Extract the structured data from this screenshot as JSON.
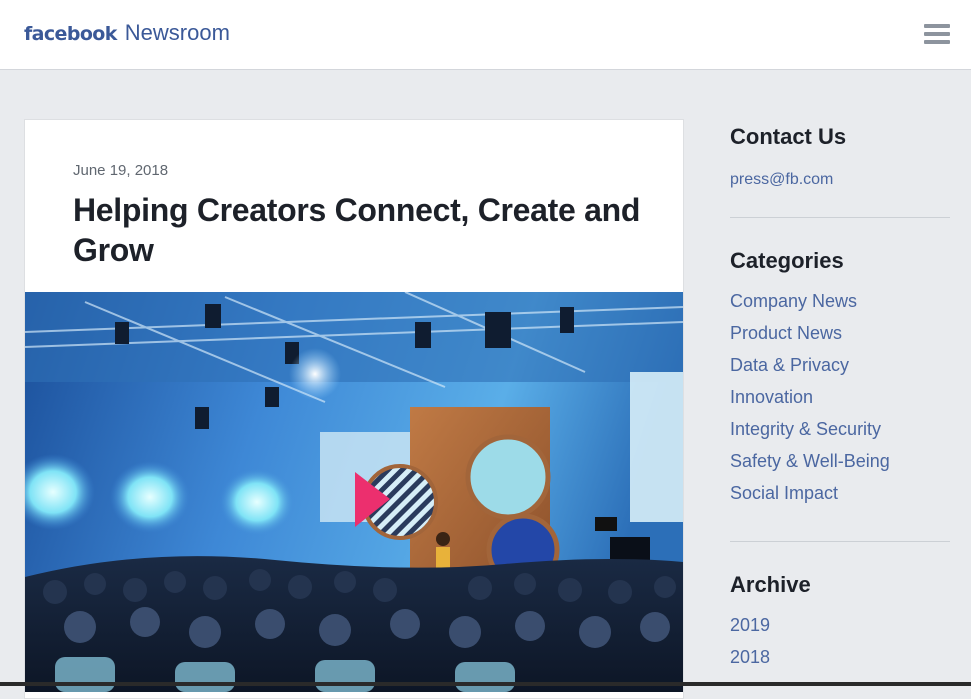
{
  "header": {
    "brand": "facebook",
    "section": "Newsroom",
    "menu_icon": "hamburger-icon"
  },
  "article": {
    "date": "June 19, 2018",
    "title": "Helping Creators Connect, Create and Grow",
    "image_alt": "Conference stage with a presenter in front of an audience"
  },
  "sidebar": {
    "contact": {
      "heading": "Contact Us",
      "email": "press@fb.com"
    },
    "categories": {
      "heading": "Categories",
      "items": [
        "Company News",
        "Product News",
        "Data & Privacy",
        "Innovation",
        "Integrity & Security",
        "Safety & Well-Being",
        "Social Impact"
      ]
    },
    "archive": {
      "heading": "Archive",
      "items": [
        "2019",
        "2018"
      ]
    }
  },
  "colors": {
    "brand": "#3b5998",
    "link": "#4b67a1",
    "background": "#e9ebee",
    "text": "#1d2129",
    "muted": "#606770"
  }
}
